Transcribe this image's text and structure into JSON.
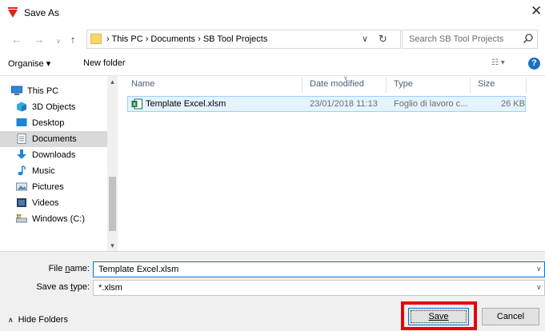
{
  "window": {
    "title": "Save As",
    "close_glyph": "✕"
  },
  "address": {
    "back_glyph": "←",
    "forward_glyph": "→",
    "up_glyph": "↑",
    "breadcrumb": "›  This PC  ›  Documents  ›  SB Tool Projects",
    "dropdown_glyph": "∨",
    "refresh_glyph": "↻",
    "search_placeholder": "Search SB Tool Projects"
  },
  "toolbar": {
    "organise_label": "Organise ▾",
    "new_folder_label": "New folder",
    "view_glyph": "☷ ▾",
    "help_glyph": "?"
  },
  "nav": {
    "scroll_up": "▴",
    "scroll_down": "▾",
    "items": [
      {
        "label": "This PC",
        "icon": "computer-icon"
      },
      {
        "label": "3D Objects",
        "icon": "3d-objects-icon"
      },
      {
        "label": "Desktop",
        "icon": "desktop-icon"
      },
      {
        "label": "Documents",
        "icon": "documents-icon",
        "selected": true
      },
      {
        "label": "Downloads",
        "icon": "downloads-icon"
      },
      {
        "label": "Music",
        "icon": "music-icon"
      },
      {
        "label": "Pictures",
        "icon": "pictures-icon"
      },
      {
        "label": "Videos",
        "icon": "videos-icon"
      },
      {
        "label": "Windows (C:)",
        "icon": "drive-icon"
      }
    ]
  },
  "columns": {
    "name": "Name",
    "date": "Date modified",
    "type": "Type",
    "size": "Size"
  },
  "files": [
    {
      "name": "Template Excel.xlsm",
      "date": "23/01/2018 11:13",
      "type": "Foglio di lavoro c...",
      "size": "26 KB"
    }
  ],
  "fields": {
    "filename_label_pre": "File ",
    "filename_label_u": "n",
    "filename_label_post": "ame:",
    "filename_value": "Template Excel.xlsm",
    "savetype_label_pre": "Save as ",
    "savetype_label_u": "t",
    "savetype_label_post": "ype:",
    "savetype_value": "*.xlsm",
    "chevron": "∨"
  },
  "footer": {
    "hide_folders_caret": "∧",
    "hide_folders_label": "Hide Folders",
    "save_label": "Save",
    "cancel_label": "Cancel"
  },
  "colors": {
    "highlight": "#e8000d",
    "accent": "#0078d7",
    "selected_row": "#e5f3ff"
  }
}
